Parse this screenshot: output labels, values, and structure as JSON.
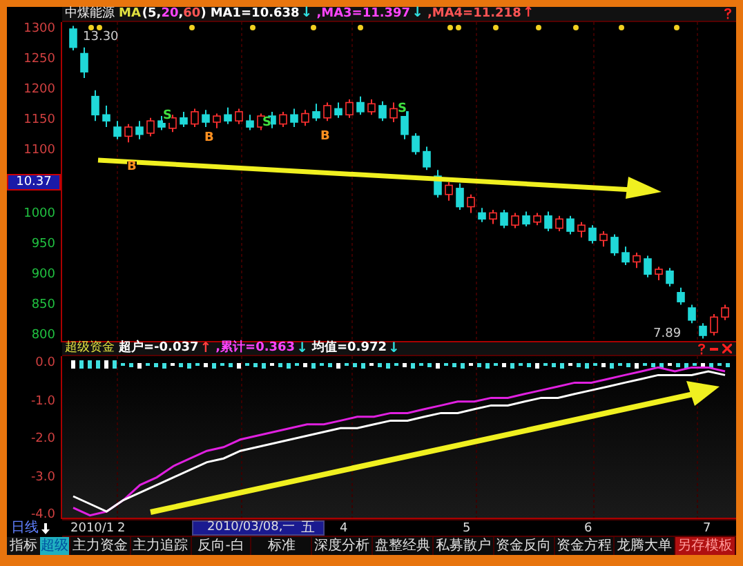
{
  "header": {
    "stock": "中煤能源",
    "ma_label": "MA",
    "ma_params": [
      {
        "text": "(5,",
        "kind": "plain"
      },
      {
        "text": "20",
        "kind": "ma3"
      },
      {
        "text": ",",
        "kind": "plain"
      },
      {
        "text": "60",
        "kind": "ma4"
      },
      {
        "text": ")",
        "kind": "plain"
      }
    ],
    "readings": [
      {
        "text": "MA1=10.638",
        "kind": "plain",
        "arrow": {
          "text": "↓",
          "kind": "down"
        }
      },
      {
        "text": ",MA3=11.397",
        "kind": "ma3",
        "arrow": {
          "text": "↓",
          "kind": "down"
        }
      },
      {
        "text": ",MA4=11.218",
        "kind": "ma4",
        "arrow": {
          "text": "↑",
          "kind": "up"
        }
      }
    ]
  },
  "main_chart": {
    "current": "10.37",
    "price_high": "13.30",
    "price_low": "7.89",
    "chart_data": {
      "type": "candlestick",
      "grid": true,
      "ylim": [
        800,
        1300
      ],
      "yticks": [
        1300,
        1250,
        1200,
        1150,
        1100,
        1000,
        950,
        900,
        850,
        800
      ],
      "ohlc": [
        [
          1300,
          1305,
          1265,
          1270
        ],
        [
          1260,
          1270,
          1220,
          1230
        ],
        [
          1190,
          1200,
          1150,
          1160
        ],
        [
          1160,
          1175,
          1140,
          1150
        ],
        [
          1140,
          1150,
          1120,
          1125
        ],
        [
          1125,
          1145,
          1115,
          1140
        ],
        [
          1140,
          1150,
          1120,
          1128
        ],
        [
          1130,
          1155,
          1125,
          1150
        ],
        [
          1150,
          1158,
          1135,
          1140
        ],
        [
          1138,
          1160,
          1132,
          1155
        ],
        [
          1155,
          1165,
          1140,
          1145
        ],
        [
          1145,
          1170,
          1140,
          1165
        ],
        [
          1160,
          1168,
          1140,
          1148
        ],
        [
          1148,
          1162,
          1138,
          1158
        ],
        [
          1160,
          1172,
          1145,
          1150
        ],
        [
          1150,
          1170,
          1145,
          1165
        ],
        [
          1150,
          1160,
          1135,
          1140
        ],
        [
          1140,
          1162,
          1135,
          1158
        ],
        [
          1158,
          1165,
          1138,
          1145
        ],
        [
          1145,
          1165,
          1140,
          1160
        ],
        [
          1160,
          1170,
          1140,
          1148
        ],
        [
          1148,
          1168,
          1142,
          1162
        ],
        [
          1165,
          1178,
          1150,
          1155
        ],
        [
          1155,
          1180,
          1150,
          1175
        ],
        [
          1170,
          1180,
          1155,
          1160
        ],
        [
          1160,
          1185,
          1155,
          1180
        ],
        [
          1180,
          1190,
          1160,
          1165
        ],
        [
          1165,
          1185,
          1160,
          1178
        ],
        [
          1175,
          1182,
          1150,
          1155
        ],
        [
          1155,
          1180,
          1148,
          1170
        ],
        [
          1165,
          1170,
          1120,
          1128
        ],
        [
          1125,
          1130,
          1095,
          1100
        ],
        [
          1100,
          1108,
          1070,
          1075
        ],
        [
          1060,
          1070,
          1025,
          1030
        ],
        [
          1030,
          1050,
          1020,
          1045
        ],
        [
          1040,
          1048,
          1005,
          1010
        ],
        [
          1010,
          1030,
          1000,
          1025
        ],
        [
          1000,
          1008,
          985,
          990
        ],
        [
          990,
          1005,
          982,
          1000
        ],
        [
          1000,
          1005,
          975,
          980
        ],
        [
          980,
          1000,
          975,
          995
        ],
        [
          995,
          1002,
          978,
          982
        ],
        [
          985,
          1000,
          980,
          995
        ],
        [
          995,
          1002,
          970,
          975
        ],
        [
          975,
          995,
          970,
          990
        ],
        [
          990,
          995,
          965,
          970
        ],
        [
          970,
          985,
          960,
          980
        ],
        [
          975,
          980,
          950,
          955
        ],
        [
          955,
          970,
          945,
          965
        ],
        [
          960,
          965,
          930,
          935
        ],
        [
          935,
          945,
          915,
          920
        ],
        [
          920,
          935,
          910,
          930
        ],
        [
          925,
          930,
          895,
          900
        ],
        [
          900,
          912,
          890,
          908
        ],
        [
          905,
          910,
          880,
          885
        ],
        [
          870,
          878,
          850,
          855
        ],
        [
          845,
          850,
          820,
          825
        ],
        [
          815,
          820,
          795,
          800
        ],
        [
          805,
          835,
          800,
          830
        ],
        [
          830,
          850,
          825,
          845
        ]
      ]
    }
  },
  "signals": [
    {
      "label": "B",
      "kind": "buy"
    },
    {
      "label": "S",
      "kind": "sell"
    },
    {
      "label": "B",
      "kind": "buy"
    },
    {
      "label": "S",
      "kind": "sell"
    },
    {
      "label": "B",
      "kind": "buy"
    },
    {
      "label": "S",
      "kind": "sell"
    }
  ],
  "indicator": {
    "name": "超级资金",
    "readings": [
      {
        "text": "超户=-0.037",
        "kind": "plain",
        "arrow": {
          "text": "↑",
          "kind": "up"
        }
      },
      {
        "text": ",累计=0.363",
        "kind": "ma3",
        "arrow": {
          "text": "↓",
          "kind": "down"
        }
      },
      {
        "text": "均值=0.972",
        "kind": "plain",
        "arrow": {
          "text": "↓",
          "kind": "down"
        }
      }
    ],
    "chart_data": {
      "type": "line",
      "grid": true,
      "ylim": [
        -4.1,
        0.2
      ],
      "yticks": [
        {
          "value": 0,
          "label": "0.0"
        },
        {
          "value": -1,
          "label": "-1.0"
        },
        {
          "value": -2,
          "label": "-2.0"
        },
        {
          "value": -3,
          "label": "-3.0"
        },
        {
          "value": -4,
          "label": "-4.0"
        }
      ],
      "series": [
        {
          "color": "#e020e0",
          "values": [
            -3.8,
            -4.0,
            -3.9,
            -3.6,
            -3.2,
            -3.0,
            -2.7,
            -2.5,
            -2.3,
            -2.2,
            -2.0,
            -1.9,
            -1.8,
            -1.7,
            -1.6,
            -1.6,
            -1.5,
            -1.4,
            -1.4,
            -1.3,
            -1.3,
            -1.2,
            -1.1,
            -1.0,
            -1.0,
            -0.9,
            -0.9,
            -0.8,
            -0.7,
            -0.6,
            -0.5,
            -0.5,
            -0.4,
            -0.3,
            -0.2,
            -0.1,
            -0.2,
            -0.1,
            -0.1,
            -0.2
          ]
        },
        {
          "color": "#ffffff",
          "values": [
            -3.5,
            -3.7,
            -3.9,
            -3.6,
            -3.4,
            -3.2,
            -3.0,
            -2.8,
            -2.6,
            -2.5,
            -2.3,
            -2.2,
            -2.1,
            -2.0,
            -1.9,
            -1.8,
            -1.7,
            -1.7,
            -1.6,
            -1.5,
            -1.5,
            -1.4,
            -1.3,
            -1.3,
            -1.2,
            -1.1,
            -1.1,
            -1.0,
            -0.9,
            -0.9,
            -0.8,
            -0.7,
            -0.6,
            -0.5,
            -0.4,
            -0.3,
            -0.3,
            -0.3,
            -0.2,
            -0.3
          ]
        }
      ]
    }
  },
  "period": "日线",
  "dates": [
    "2010/1",
    "2",
    "4",
    "5",
    "6",
    "7"
  ],
  "cursor": {
    "date": "2010/03/08,一",
    "weekday": "五"
  },
  "tab_label": "指标",
  "tabs": [
    {
      "label": "超级",
      "kind": "tab",
      "selected": true
    },
    {
      "label": "主力资金",
      "kind": "tab",
      "selected": false
    },
    {
      "label": "主力追踪",
      "kind": "tab",
      "selected": false
    },
    {
      "label": "反向-白",
      "kind": "tab",
      "selected": false
    },
    {
      "label": "标准",
      "kind": "tab",
      "selected": false
    },
    {
      "label": "深度分析",
      "kind": "tab",
      "selected": false
    },
    {
      "label": "盘整经典",
      "kind": "tab",
      "selected": false
    },
    {
      "label": "私募散户",
      "kind": "tab",
      "selected": false
    },
    {
      "label": "资金反向",
      "kind": "tab",
      "selected": false
    },
    {
      "label": "资金方程",
      "kind": "tab",
      "selected": false
    },
    {
      "label": "龙腾大单",
      "kind": "tab",
      "selected": false
    },
    {
      "label": "另存模板",
      "kind": "action",
      "selected": false
    }
  ]
}
